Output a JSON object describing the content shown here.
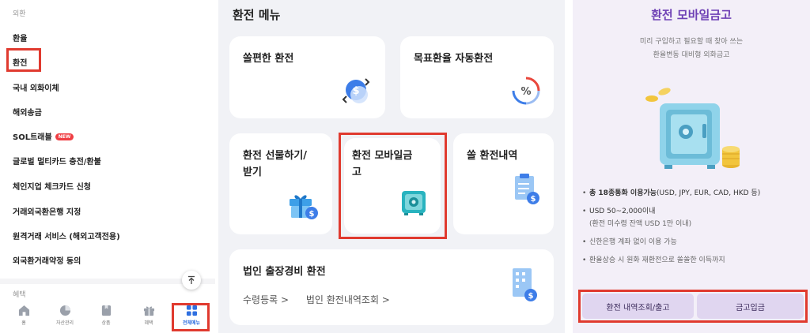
{
  "menu_panel": {
    "section_title": "외환",
    "items": [
      {
        "label": "환율"
      },
      {
        "label": "환전"
      },
      {
        "label": "국내 외화이체"
      },
      {
        "label": "해외송금"
      },
      {
        "label": "SOL트래블",
        "badge": "NEW"
      },
      {
        "label": "글로벌 멀티카드 충전/환불"
      },
      {
        "label": "체인지업 체크카드 신청"
      },
      {
        "label": "거래외국환은행 지정"
      },
      {
        "label": "원격거래 서비스 (해외고객전용)"
      },
      {
        "label": "외국환거래약정 동의"
      }
    ],
    "next_section_title": "혜택",
    "tab_bar": [
      {
        "label": "홈",
        "icon": "home-icon"
      },
      {
        "label": "자산관리",
        "icon": "pie-chart-icon"
      },
      {
        "label": "상품",
        "icon": "product-icon"
      },
      {
        "label": "혜택",
        "icon": "gift-icon"
      },
      {
        "label": "전체메뉴",
        "icon": "grid-menu-icon",
        "active": true
      }
    ],
    "highlight_color": "#e03a2f"
  },
  "exchange_panel": {
    "title": "환전 메뉴",
    "cards": {
      "easy_exchange": "쏠편한 환전",
      "target_rate": "목표환율 자동환전",
      "gift": "환전 선물하기/\n받기",
      "mobile_safe": "환전 모바일금\n고",
      "history": "쏠 환전내역",
      "corporate": "법인 출장경비 환전"
    },
    "corporate_links": [
      "수령등록 >",
      "법인 환전내역조회 >"
    ]
  },
  "safe_panel": {
    "title": "환전 모바일금고",
    "description": [
      "미리 구입하고 필요할 때 찾아 쓰는",
      "환율변동 대비형 외화금고"
    ],
    "bullets": {
      "b1_bold": "총 18종통화 이용가능",
      "b1_rest": "(USD, JPY, EUR, CAD, HKD 등)",
      "b2": "USD 50~2,000이내",
      "b2_sub": "(환전 미수령 잔액 USD 1만 이내)",
      "b3": "신한은행 계좌 없이 이용 가능",
      "b4": "환율상승 시 원화 재환전으로 쏠쏠한 이득까지"
    },
    "buttons": {
      "history": "환전 내역조회/출고",
      "deposit": "금고입금"
    },
    "accent_color": "#6f41b5"
  }
}
